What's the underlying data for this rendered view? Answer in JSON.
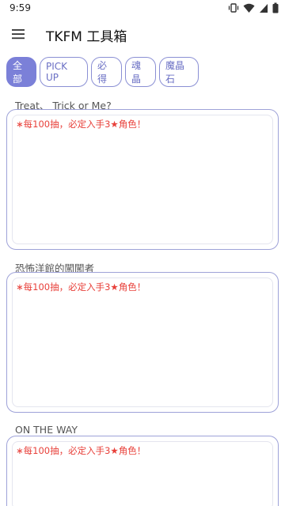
{
  "status_bar": {
    "time": "9:59",
    "icons": [
      "vibrate-icon",
      "wifi-icon",
      "cellular-icon",
      "battery-icon"
    ]
  },
  "app_bar": {
    "title": "TKFM 工具箱",
    "menu_icon": "hamburger-menu-icon"
  },
  "filter_chips": [
    {
      "label": "全部",
      "selected": true
    },
    {
      "label": "PICK UP",
      "selected": false
    },
    {
      "label": "必得",
      "selected": false
    },
    {
      "label": "魂晶",
      "selected": false
    },
    {
      "label": "魔晶石",
      "selected": false
    }
  ],
  "banners": [
    {
      "title": "Treat、 Trick or Me?",
      "notice": "∗每100抽，必定入手3★角色！"
    },
    {
      "title": "恐怖洋館的闖闖者",
      "notice": "∗每100抽，必定入手3★角色！"
    },
    {
      "title": "ON THE WAY",
      "notice": "∗每100抽，必定入手3★角色！"
    }
  ],
  "colors": {
    "accent": "#7b80d8",
    "chip_border": "#8a8fd4",
    "notice_red": "#e8403a",
    "card_border": "#9ea2d8"
  }
}
